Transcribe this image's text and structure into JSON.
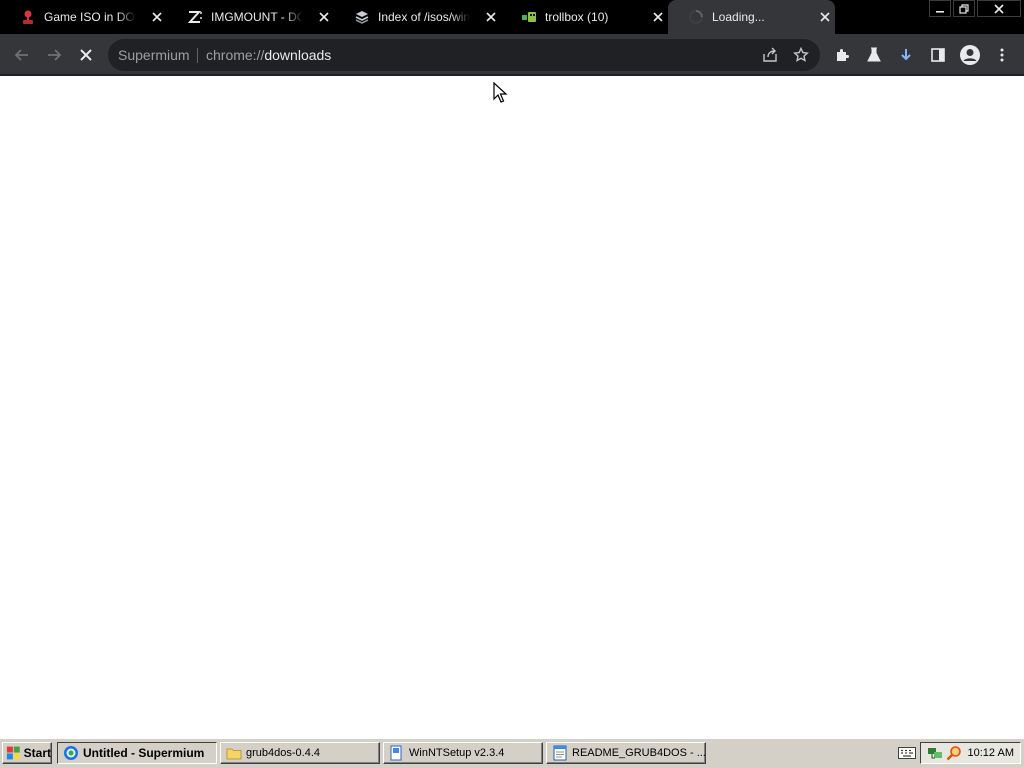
{
  "browser": {
    "tabs": [
      {
        "title": "Game ISO in DOSBo",
        "icon": "dosbox-joystick-icon"
      },
      {
        "title": "IMGMOUNT - DOSB",
        "icon": "z-logo-icon"
      },
      {
        "title": "Index of /isos/windo",
        "icon": "server-icon"
      },
      {
        "title": "trollbox (10)",
        "icon": "trollbox-icon"
      },
      {
        "title": "Loading...",
        "icon": "loading-spinner-icon",
        "active": true
      }
    ],
    "omnibox": {
      "chip": "Supermium",
      "url_prefix": "chrome://",
      "url_host": "downloads"
    },
    "accent_color": "#8ab4f8"
  },
  "taskbar": {
    "start_label": "Start",
    "tasks": [
      {
        "label": "Untitled - Supermium",
        "icon": "supermium-icon",
        "active": true
      },
      {
        "label": "grub4dos-0.4.4",
        "icon": "folder-icon"
      },
      {
        "label": "WinNTSetup v2.3.4",
        "icon": "setup-icon"
      },
      {
        "label": "README_GRUB4DOS - ...",
        "icon": "notepad-icon"
      }
    ],
    "clock": "10:12 AM"
  }
}
